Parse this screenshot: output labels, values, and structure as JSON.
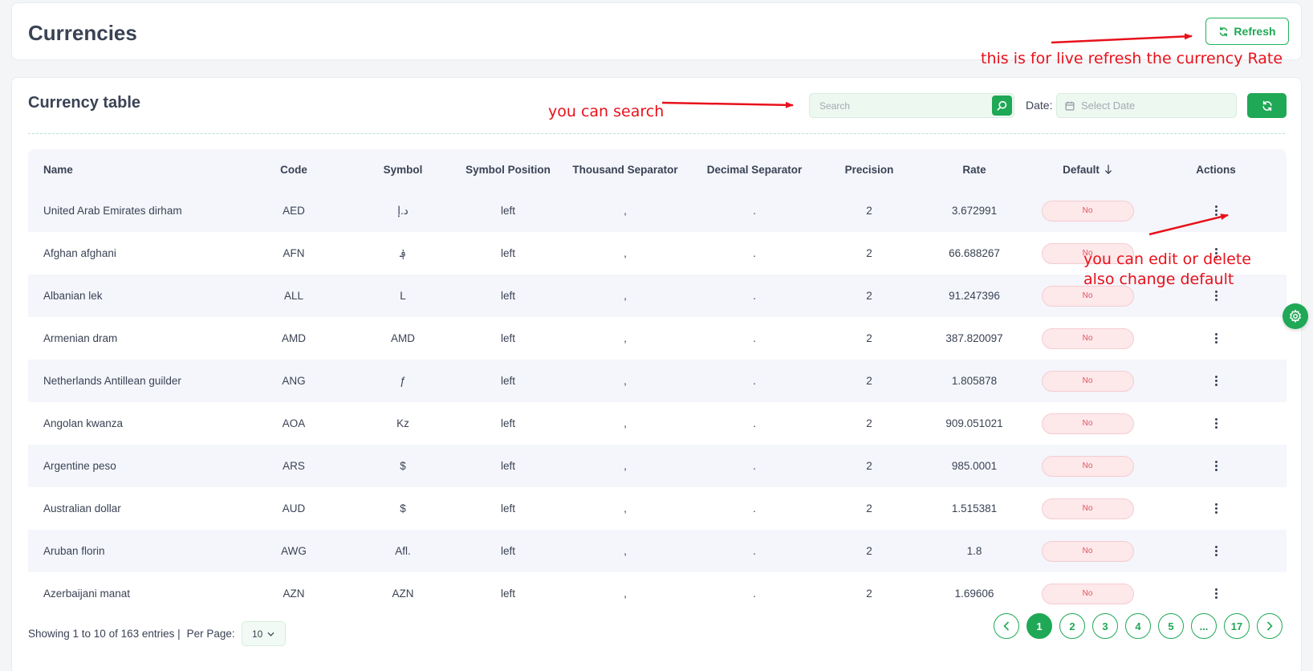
{
  "header": {
    "title": "Currencies",
    "refresh_label": "Refresh"
  },
  "table_section": {
    "title": "Currency table",
    "search_placeholder": "Search",
    "date_label": "Date:",
    "date_placeholder": "Select Date"
  },
  "columns": [
    "Name",
    "Code",
    "Symbol",
    "Symbol Position",
    "Thousand Separator",
    "Decimal Separator",
    "Precision",
    "Rate",
    "Default",
    "Actions"
  ],
  "rows": [
    {
      "name": "United Arab Emirates dirham",
      "code": "AED",
      "symbol": "د.إ",
      "position": "left",
      "thousand": ",",
      "decimal": ".",
      "precision": "2",
      "rate": "3.672991",
      "default": "No"
    },
    {
      "name": "Afghan afghani",
      "code": "AFN",
      "symbol": "؋",
      "position": "left",
      "thousand": ",",
      "decimal": ".",
      "precision": "2",
      "rate": "66.688267",
      "default": "No"
    },
    {
      "name": "Albanian lek",
      "code": "ALL",
      "symbol": "L",
      "position": "left",
      "thousand": ",",
      "decimal": ".",
      "precision": "2",
      "rate": "91.247396",
      "default": "No"
    },
    {
      "name": "Armenian dram",
      "code": "AMD",
      "symbol": "AMD",
      "position": "left",
      "thousand": ",",
      "decimal": ".",
      "precision": "2",
      "rate": "387.820097",
      "default": "No"
    },
    {
      "name": "Netherlands Antillean guilder",
      "code": "ANG",
      "symbol": "ƒ",
      "position": "left",
      "thousand": ",",
      "decimal": ".",
      "precision": "2",
      "rate": "1.805878",
      "default": "No"
    },
    {
      "name": "Angolan kwanza",
      "code": "AOA",
      "symbol": "Kz",
      "position": "left",
      "thousand": ",",
      "decimal": ".",
      "precision": "2",
      "rate": "909.051021",
      "default": "No"
    },
    {
      "name": "Argentine peso",
      "code": "ARS",
      "symbol": "$",
      "position": "left",
      "thousand": ",",
      "decimal": ".",
      "precision": "2",
      "rate": "985.0001",
      "default": "No"
    },
    {
      "name": "Australian dollar",
      "code": "AUD",
      "symbol": "$",
      "position": "left",
      "thousand": ",",
      "decimal": ".",
      "precision": "2",
      "rate": "1.515381",
      "default": "No"
    },
    {
      "name": "Aruban florin",
      "code": "AWG",
      "symbol": "Afl.",
      "position": "left",
      "thousand": ",",
      "decimal": ".",
      "precision": "2",
      "rate": "1.8",
      "default": "No"
    },
    {
      "name": "Azerbaijani manat",
      "code": "AZN",
      "symbol": "AZN",
      "position": "left",
      "thousand": ",",
      "decimal": ".",
      "precision": "2",
      "rate": "1.69606",
      "default": "No"
    }
  ],
  "footer": {
    "showing_text": "Showing 1 to 10 of 163 entries |",
    "per_page_label": "Per Page:",
    "per_page_value": "10",
    "pages": [
      "1",
      "2",
      "3",
      "4",
      "5",
      "...",
      "17"
    ],
    "active_page": "1"
  },
  "annotations": {
    "refresh_note": "this is for live refresh the currency Rate",
    "search_note": "you can search",
    "actions_note_line1": "you can edit or delete",
    "actions_note_line2": "also change default"
  },
  "colors": {
    "accent": "#1fa855",
    "danger_text": "#e2525f",
    "danger_bg": "#fde8ea",
    "annotation": "#e8111b"
  },
  "icons": {
    "refresh": "refresh-icon",
    "search": "search-icon",
    "calendar": "calendar-icon",
    "reload": "reload-icon",
    "sort": "sort-down-arrow-icon",
    "actions": "kebab-menu-icon",
    "settings": "gear-icon"
  }
}
